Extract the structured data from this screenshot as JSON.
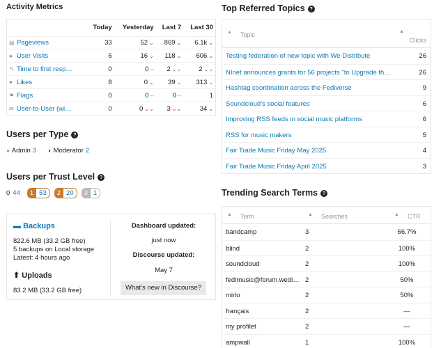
{
  "activity": {
    "title": "Activity Metrics",
    "headers": [
      "Today",
      "Yesterday",
      "Last 7",
      "Last 30"
    ],
    "rows": [
      {
        "icon": "file-icon",
        "label": "Pageviews",
        "today": "33",
        "yesterday": "52",
        "y_trend": "down",
        "last7": "869",
        "l7_trend": "down",
        "last30": "6.1k",
        "l30_trend": "down"
      },
      {
        "icon": "user-icon",
        "label": "User Visits",
        "today": "6",
        "yesterday": "16",
        "y_trend": "down",
        "last7": "118",
        "l7_trend": "down",
        "last30": "606",
        "l30_trend": "down"
      },
      {
        "icon": "reply-icon",
        "label": "Time to first resp…",
        "today": "0",
        "yesterday": "0",
        "y_trend": "flat",
        "last7": "2",
        "l7_trend": "up",
        "last30": "2",
        "l30_trend": "up"
      },
      {
        "icon": "heart-icon",
        "label": "Likes",
        "today": "8",
        "yesterday": "0",
        "y_trend": "down",
        "last7": "39",
        "l7_trend": "down",
        "last30": "313",
        "l30_trend": "down"
      },
      {
        "icon": "flag-icon",
        "label": "Flags",
        "today": "0",
        "yesterday": "0",
        "y_trend": "flat",
        "last7": "0",
        "l7_trend": "flat",
        "last30": "1",
        "l30_trend": "none"
      },
      {
        "icon": "envelope-icon",
        "label": "User-to-User (wi…",
        "today": "0",
        "yesterday": "0",
        "y_trend": "down2",
        "last7": "3",
        "l7_trend": "down2",
        "last30": "34",
        "l30_trend": "down"
      }
    ]
  },
  "users_per_type": {
    "title": "Users per Type",
    "items": [
      {
        "label": "Admin",
        "count": "3"
      },
      {
        "label": "Moderator",
        "count": "2"
      }
    ]
  },
  "users_per_trust": {
    "title": "Users per Trust Level",
    "levels": [
      {
        "level": "0",
        "count": "44",
        "color": ""
      },
      {
        "level": "1",
        "count": "53",
        "color": "#c97a2a"
      },
      {
        "level": "2",
        "count": "20",
        "color": "#c97a2a"
      },
      {
        "level": "3",
        "count": "1",
        "color": "#b8b8b8"
      }
    ]
  },
  "backups": {
    "title": "Backups",
    "size": "822.6 MB (33.2 GB free)",
    "count_line": "5 backups on Local storage",
    "latest": "Latest: 4 hours ago",
    "uploads_title": "Uploads",
    "uploads_size": "83.2 MB (33.2 GB free)",
    "dashboard_updated_label": "Dashboard updated:",
    "dashboard_updated_value": "just now",
    "discourse_updated_label": "Discourse updated:",
    "discourse_updated_value": "May 7",
    "whats_new_button": "What's new in Discourse?"
  },
  "top_referred": {
    "title": "Top Referred Topics",
    "col_topic": "Topic",
    "col_clicks": "Clicks",
    "rows": [
      {
        "topic": "Testing federation of new topic with We Distribute",
        "clicks": "26"
      },
      {
        "topic": "NInet announces grants for 56 projects \"to Upgrade the Internet\"",
        "clicks": "26"
      },
      {
        "topic": "Hashtag coordination across the Fediverse",
        "clicks": "9"
      },
      {
        "topic": "Soundcloud's social features",
        "clicks": "6"
      },
      {
        "topic": "Improving RSS feeds in social music platforms",
        "clicks": "6"
      },
      {
        "topic": "RSS for music makers",
        "clicks": "5"
      },
      {
        "topic": "Fair Trade Music Friday May 2025",
        "clicks": "4"
      },
      {
        "topic": "Fair Trade Music Friday April 2025",
        "clicks": "3"
      }
    ]
  },
  "trending_search": {
    "title": "Trending Search Terms",
    "col_term": "Term",
    "col_searches": "Searches",
    "col_ctr": "CTR",
    "rows": [
      {
        "term": "bandcamp",
        "searches": "3",
        "ctr": "66.7%"
      },
      {
        "term": "blind",
        "searches": "2",
        "ctr": "100%"
      },
      {
        "term": "soundcloud",
        "searches": "2",
        "ctr": "100%"
      },
      {
        "term": "fedimusic@forum.wedistribute.org",
        "searches": "2",
        "ctr": "50%"
      },
      {
        "term": "mirlo",
        "searches": "2",
        "ctr": "50%"
      },
      {
        "term": "français",
        "searches": "2",
        "ctr": "—"
      },
      {
        "term": "my profilet",
        "searches": "2",
        "ctr": "—"
      },
      {
        "term": "ampwall",
        "searches": "1",
        "ctr": "100%"
      }
    ]
  },
  "colors": {
    "link": "#0c7bb3",
    "down": "#d32f2f",
    "up": "#2e9c3a"
  }
}
